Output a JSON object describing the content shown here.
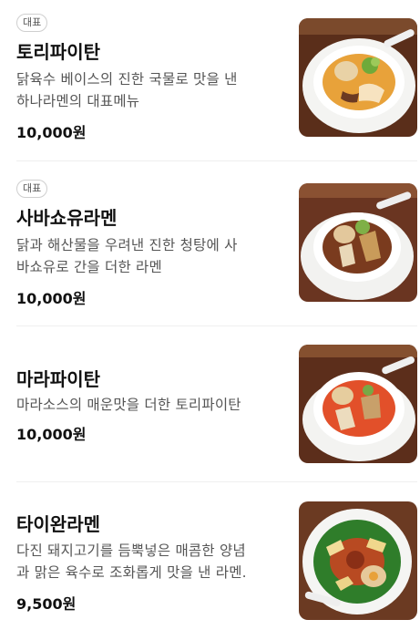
{
  "menu": {
    "items": [
      {
        "badge": "대표",
        "name": "토리파이탄",
        "desc_line1": "닭육수 베이스의 진한 국물로 맛을 낸",
        "desc_line2": "하나라멘의 대표메뉴",
        "price": "10,000원",
        "image_icon": "chicken-paitan-ramen-photo",
        "broth_color": "#e8a23a"
      },
      {
        "badge": "대표",
        "name": "사바쇼유라멘",
        "desc_line1": "닭과 해산물을 우려낸 진한 청탕에 사",
        "desc_line2": "바쇼유로 간을 더한 라멘",
        "price": "10,000원",
        "image_icon": "saba-shoyu-ramen-photo",
        "broth_color": "#7a3b1e"
      },
      {
        "badge": "",
        "name": "마라파이탄",
        "desc_line1": "마라소스의 매운맛을 더한 토리파이탄",
        "desc_line2": "",
        "price": "10,000원",
        "image_icon": "mala-paitan-ramen-photo",
        "broth_color": "#e2502a"
      },
      {
        "badge": "",
        "name": "타이완라멘",
        "desc_line1": "다진 돼지고기를 듬뿍넣은 매콤한 양념",
        "desc_line2": "과 맑은 육수로 조화롭게 맛을 낸 라멘.",
        "price": "9,500원",
        "image_icon": "taiwan-ramen-photo",
        "broth_color": "#2f7d2a"
      }
    ]
  }
}
